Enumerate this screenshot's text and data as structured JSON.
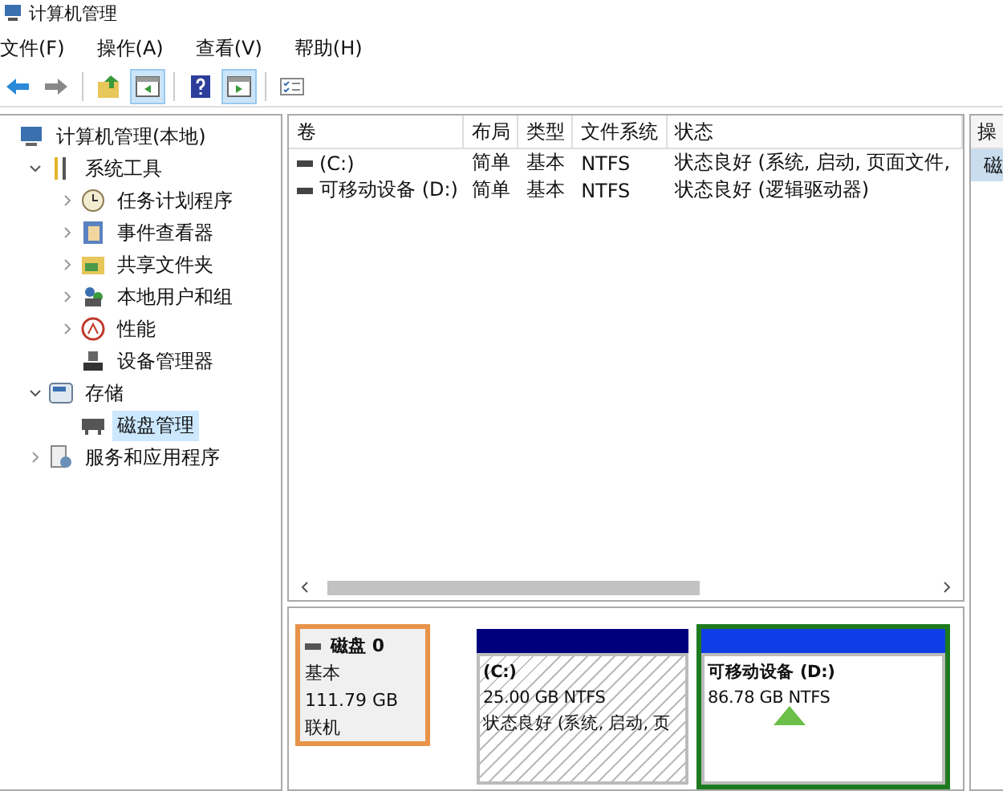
{
  "window": {
    "title": "计算机管理"
  },
  "menu": [
    "文件(F)",
    "操作(A)",
    "查看(V)",
    "帮助(H)"
  ],
  "toolbar": [
    {
      "kind": "back",
      "pressed": false
    },
    {
      "kind": "forward",
      "pressed": false
    },
    {
      "kind": "sep"
    },
    {
      "kind": "up",
      "pressed": false
    },
    {
      "kind": "tree",
      "pressed": true
    },
    {
      "kind": "sep"
    },
    {
      "kind": "help",
      "pressed": false
    },
    {
      "kind": "pane",
      "pressed": true
    },
    {
      "kind": "sep"
    },
    {
      "kind": "props",
      "pressed": false
    }
  ],
  "tree": [
    {
      "label": "计算机管理(本地)",
      "kind": "computer",
      "selected": false,
      "children": [
        {
          "label": "系统工具",
          "kind": "tools",
          "expanded": true,
          "selected": false,
          "children": [
            {
              "label": "任务计划程序",
              "kind": "clock",
              "expanded": false,
              "selected": false
            },
            {
              "label": "事件查看器",
              "kind": "log",
              "expanded": false,
              "selected": false
            },
            {
              "label": "共享文件夹",
              "kind": "share",
              "expanded": false,
              "selected": false
            },
            {
              "label": "本地用户和组",
              "kind": "users",
              "expanded": false,
              "selected": false
            },
            {
              "label": "性能",
              "kind": "gauge",
              "expanded": false,
              "selected": false
            },
            {
              "label": "设备管理器",
              "kind": "device",
              "selected": false
            }
          ]
        },
        {
          "label": "存储",
          "kind": "storage",
          "expanded": true,
          "selected": false,
          "children": [
            {
              "label": "磁盘管理",
              "kind": "disk",
              "selected": true
            }
          ]
        },
        {
          "label": "服务和应用程序",
          "kind": "services",
          "expanded": false,
          "selected": false
        }
      ]
    }
  ],
  "table": {
    "columns": [
      "卷",
      "布局",
      "类型",
      "文件系统",
      "状态"
    ],
    "rows": [
      {
        "cells": [
          "(C:)",
          "简单",
          "基本",
          "NTFS",
          "状态良好 (系统, 启动, 页面文件,"
        ]
      },
      {
        "cells": [
          "可移动设备 (D:)",
          "简单",
          "基本",
          "NTFS",
          "状态良好 (逻辑驱动器)"
        ]
      }
    ]
  },
  "disk": {
    "name": "磁盘 0",
    "type": "基本",
    "size": "111.79 GB",
    "status": "联机",
    "selected": true
  },
  "partitions": [
    {
      "label": "(C:)",
      "size": "25.00 GB NTFS",
      "status": "状态良好 (系统, 启动, 页",
      "kind": "primary",
      "selected": false
    },
    {
      "label": "可移动设备 (D:)",
      "size": "86.78 GB NTFS",
      "kind": "logical",
      "selected": true
    }
  ],
  "actions": {
    "header": "操",
    "item": "磁"
  }
}
